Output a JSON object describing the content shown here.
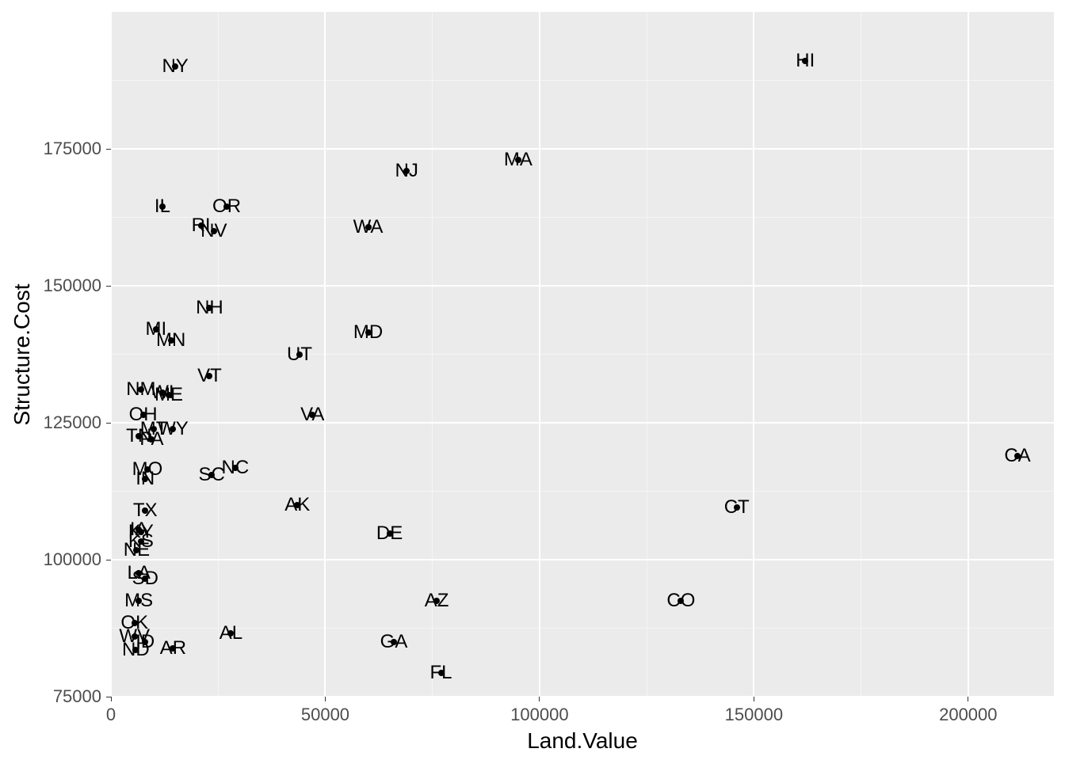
{
  "chart_data": {
    "type": "scatter",
    "xlabel": "Land.Value",
    "ylabel": "Structure.Cost",
    "xlim": [
      0,
      220000
    ],
    "ylim": [
      75000,
      200000
    ],
    "x_breaks": [
      0,
      50000,
      100000,
      150000,
      200000
    ],
    "y_breaks": [
      75000,
      100000,
      125000,
      150000,
      175000
    ],
    "points": [
      {
        "state": "NY",
        "x": 15000,
        "y": 190000
      },
      {
        "state": "HI",
        "x": 162000,
        "y": 191000
      },
      {
        "state": "MA",
        "x": 95000,
        "y": 173000
      },
      {
        "state": "NJ",
        "x": 69000,
        "y": 171000
      },
      {
        "state": "IL",
        "x": 12000,
        "y": 164500
      },
      {
        "state": "OR",
        "x": 27000,
        "y": 164500
      },
      {
        "state": "RI",
        "x": 21000,
        "y": 161000
      },
      {
        "state": "NV",
        "x": 24000,
        "y": 160000
      },
      {
        "state": "WA",
        "x": 60000,
        "y": 160700
      },
      {
        "state": "NH",
        "x": 23000,
        "y": 146000
      },
      {
        "state": "MI",
        "x": 10500,
        "y": 142000
      },
      {
        "state": "MN",
        "x": 14000,
        "y": 140000
      },
      {
        "state": "MD",
        "x": 60000,
        "y": 141500
      },
      {
        "state": "UT",
        "x": 44000,
        "y": 137500
      },
      {
        "state": "VT",
        "x": 23000,
        "y": 133500
      },
      {
        "state": "NM",
        "x": 7000,
        "y": 131000
      },
      {
        "state": "WI",
        "x": 12000,
        "y": 130500
      },
      {
        "state": "ME",
        "x": 13500,
        "y": 130000
      },
      {
        "state": "OH",
        "x": 7500,
        "y": 126500
      },
      {
        "state": "VA",
        "x": 47000,
        "y": 126500
      },
      {
        "state": "MT",
        "x": 10000,
        "y": 123800
      },
      {
        "state": "WY",
        "x": 14500,
        "y": 123800
      },
      {
        "state": "TN",
        "x": 6500,
        "y": 122500
      },
      {
        "state": "PA",
        "x": 9500,
        "y": 122000
      },
      {
        "state": "CA",
        "x": 211500,
        "y": 119000
      },
      {
        "state": "NC",
        "x": 29000,
        "y": 116800
      },
      {
        "state": "MO",
        "x": 8500,
        "y": 116500
      },
      {
        "state": "SC",
        "x": 23500,
        "y": 115500
      },
      {
        "state": "IN",
        "x": 8000,
        "y": 114700
      },
      {
        "state": "AK",
        "x": 43500,
        "y": 110000
      },
      {
        "state": "CT",
        "x": 146000,
        "y": 109500
      },
      {
        "state": "TX",
        "x": 8000,
        "y": 109000
      },
      {
        "state": "IA",
        "x": 6500,
        "y": 105500
      },
      {
        "state": "KY",
        "x": 7000,
        "y": 105000
      },
      {
        "state": "DE",
        "x": 65000,
        "y": 104700
      },
      {
        "state": "KS",
        "x": 7000,
        "y": 103300
      },
      {
        "state": "NE",
        "x": 6000,
        "y": 101800
      },
      {
        "state": "LA",
        "x": 6500,
        "y": 97500
      },
      {
        "state": "SD",
        "x": 8000,
        "y": 96500
      },
      {
        "state": "CO",
        "x": 133000,
        "y": 92500
      },
      {
        "state": "MS",
        "x": 6500,
        "y": 92500
      },
      {
        "state": "AZ",
        "x": 76000,
        "y": 92500
      },
      {
        "state": "OK",
        "x": 5500,
        "y": 88500
      },
      {
        "state": "AL",
        "x": 28000,
        "y": 86500
      },
      {
        "state": "WV",
        "x": 5500,
        "y": 86000
      },
      {
        "state": "GA",
        "x": 66000,
        "y": 85000
      },
      {
        "state": "ID",
        "x": 8000,
        "y": 85000
      },
      {
        "state": "AR",
        "x": 14500,
        "y": 83800
      },
      {
        "state": "ND",
        "x": 5800,
        "y": 83500
      },
      {
        "state": "FL",
        "x": 77000,
        "y": 79300
      }
    ]
  }
}
